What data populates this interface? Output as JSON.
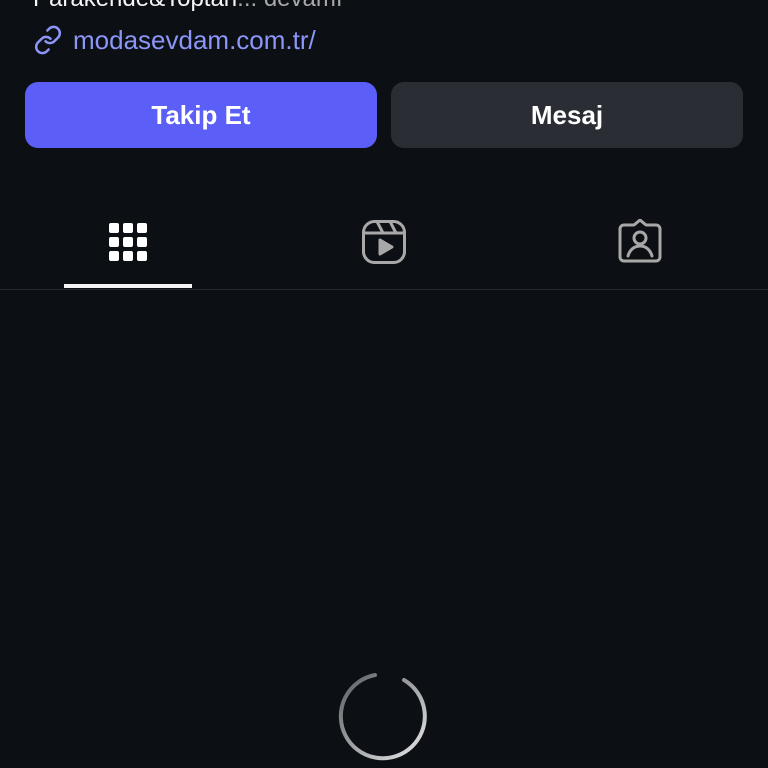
{
  "profile": {
    "bio_text": "Parakende&Toptan",
    "bio_more": "... devamı",
    "link_icon": "link-icon",
    "link_text": "modasevdam.com.tr/"
  },
  "actions": {
    "follow_label": "Takip Et",
    "message_label": "Mesaj"
  },
  "tabs": {
    "selected": "grid",
    "items": [
      {
        "id": "grid",
        "icon": "grid-icon"
      },
      {
        "id": "reels",
        "icon": "reels-icon"
      },
      {
        "id": "tagged",
        "icon": "tagged-icon"
      }
    ]
  },
  "content": {
    "loading_icon": "loading-spinner-icon"
  },
  "colors": {
    "background": "#0c1014",
    "follow_button": "#5b5ff8",
    "message_button": "#2a2e34",
    "link": "#8c95f8",
    "text": "#f5f5f5",
    "muted_text": "#a8a8a8"
  }
}
